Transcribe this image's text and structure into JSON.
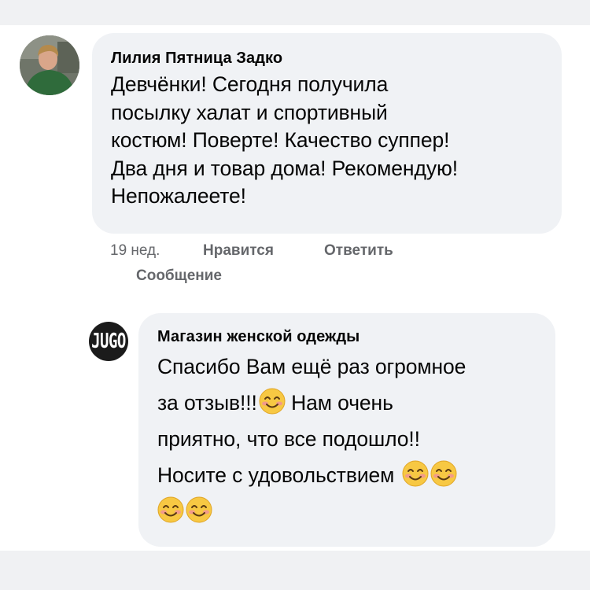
{
  "comment": {
    "author": "Лилия Пятница Задко",
    "text": "Девчёнки!  Сегодня получила\nпосылку халат и спортивный\nкостюм!  Поверте!  Качество суппер!\nДва дня и товар дома!  Рекомендую!\nНепожалеете!",
    "time": "19 нед.",
    "like_label": "Нравится",
    "reply_label": "Ответить",
    "message_label": "Сообщение"
  },
  "reply": {
    "logo_text": "JUGO",
    "author": "Магазин женской одежды",
    "line1": "Спасибо Вам ещё раз огромное",
    "line2_a": "за отзыв!!!",
    "line2_b": " Нам очень",
    "line3": "приятно, что все подошло!!",
    "line4": "Носите с удовольствием "
  },
  "colors": {
    "bubble": "#f0f2f5",
    "secondary_text": "#65676b",
    "band": "#f0f1f3"
  },
  "icons": {
    "emoji": "smiling-face-icon"
  }
}
